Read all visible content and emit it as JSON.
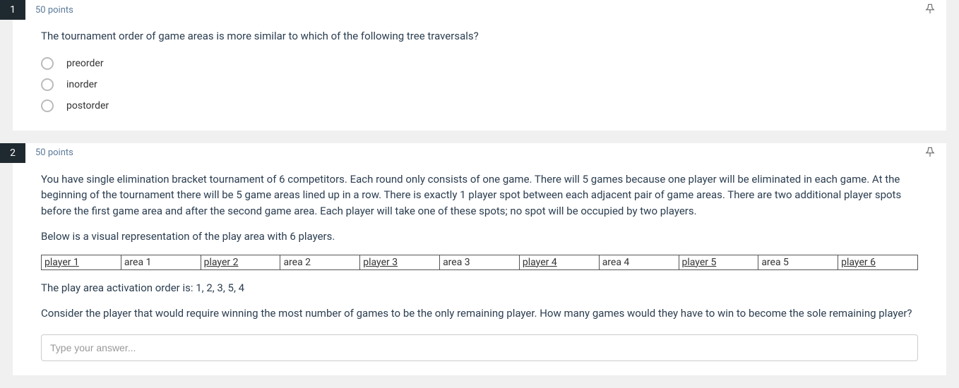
{
  "questions": [
    {
      "number": "1",
      "points": "50 points",
      "text": "The tournament order of game areas is more similar to which of the following tree traversals?",
      "options": [
        "preorder",
        "inorder",
        "postorder"
      ]
    },
    {
      "number": "2",
      "points": "50 points",
      "para1": "You have single elimination bracket tournament of 6 competitors. Each round only consists of one game.  There will 5 games because one player will be eliminated in each game. At the beginning of the tournament there will be 5 game areas lined up in a row.  There is exactly 1 player spot between each adjacent pair of game areas.  There are two additional player spots before the first game area and after the second game area.  Each player will take one of these spots; no spot will be occupied by two players.",
      "para2": "Below is a visual representation of the play area with 6 players.",
      "play_area": [
        {
          "label": "player 1",
          "type": "player"
        },
        {
          "label": "area 1",
          "type": "area"
        },
        {
          "label": "player 2",
          "type": "player"
        },
        {
          "label": "area 2",
          "type": "area"
        },
        {
          "label": "player 3",
          "type": "player"
        },
        {
          "label": "area 3",
          "type": "area"
        },
        {
          "label": "player 4",
          "type": "player"
        },
        {
          "label": "area 4",
          "type": "area"
        },
        {
          "label": "player 5",
          "type": "player"
        },
        {
          "label": "area 5",
          "type": "area"
        },
        {
          "label": "player 6",
          "type": "player"
        }
      ],
      "para3": "The play area activation order is: 1, 2, 3, 5, 4",
      "para4": "Consider the player that would require winning the most number of games to be the only remaining player. How many games would they have to win to become the sole remaining player?",
      "answer_placeholder": "Type your answer..."
    }
  ]
}
